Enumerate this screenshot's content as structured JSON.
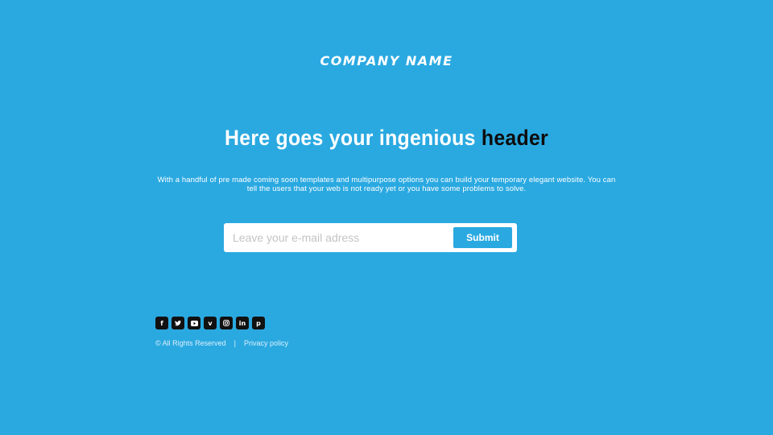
{
  "brand": {
    "name": "COMPANY NAME"
  },
  "hero": {
    "title_main": "Here goes your ingenious",
    "title_accent": "header",
    "subtext": "With a handful of pre made coming soon templates and  multipurpose  options you can build your temporary elegant website. You can tell the users that your web is not ready yet or you have some problems to solve."
  },
  "signup": {
    "email_placeholder": "Leave your e-mail adress",
    "email_value": "",
    "submit_label": "Submit"
  },
  "social": [
    {
      "name": "facebook-icon",
      "glyph": "f"
    },
    {
      "name": "twitter-icon",
      "glyph": ""
    },
    {
      "name": "youtube-icon",
      "glyph": ""
    },
    {
      "name": "vimeo-icon",
      "glyph": "v"
    },
    {
      "name": "instagram-icon",
      "glyph": ""
    },
    {
      "name": "linkedin-icon",
      "glyph": "in"
    },
    {
      "name": "pinterest-icon",
      "glyph": "p"
    }
  ],
  "footer": {
    "copyright": "© All Rights Reserved",
    "separator": "|",
    "privacy_label": "Privacy policy"
  },
  "colors": {
    "background": "#2aa9e1",
    "accent_text": "#0d0d0d",
    "social_bg": "#111111"
  }
}
